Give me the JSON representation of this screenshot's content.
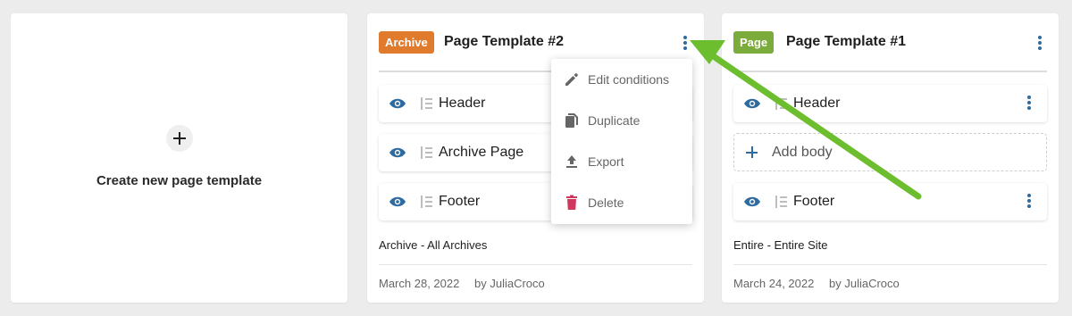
{
  "create_card": {
    "label": "Create new page template"
  },
  "templates": [
    {
      "badge": "Archive",
      "title": "Page Template #2",
      "parts": [
        "Header",
        "Archive Page",
        "Footer"
      ],
      "conditions": "Archive - All Archives",
      "date": "March 28, 2022",
      "author": "by JuliaCroco"
    },
    {
      "badge": "Page",
      "title": "Page Template #1",
      "parts": [
        "Header",
        "Footer"
      ],
      "add_body": "Add body",
      "conditions": "Entire - Entire Site",
      "date": "March 24, 2022",
      "author": "by JuliaCroco"
    }
  ],
  "context_menu": {
    "items": [
      {
        "label": "Edit conditions",
        "icon": "pencil-icon"
      },
      {
        "label": "Duplicate",
        "icon": "copy-icon"
      },
      {
        "label": "Export",
        "icon": "upload-icon"
      },
      {
        "label": "Delete",
        "icon": "trash-icon"
      }
    ]
  },
  "colors": {
    "archive_badge": "#e07b2e",
    "page_badge": "#7bab3b",
    "accent_blue": "#2d6aa0",
    "delete_red": "#d0375c",
    "arrow_green": "#6cbe2e"
  }
}
